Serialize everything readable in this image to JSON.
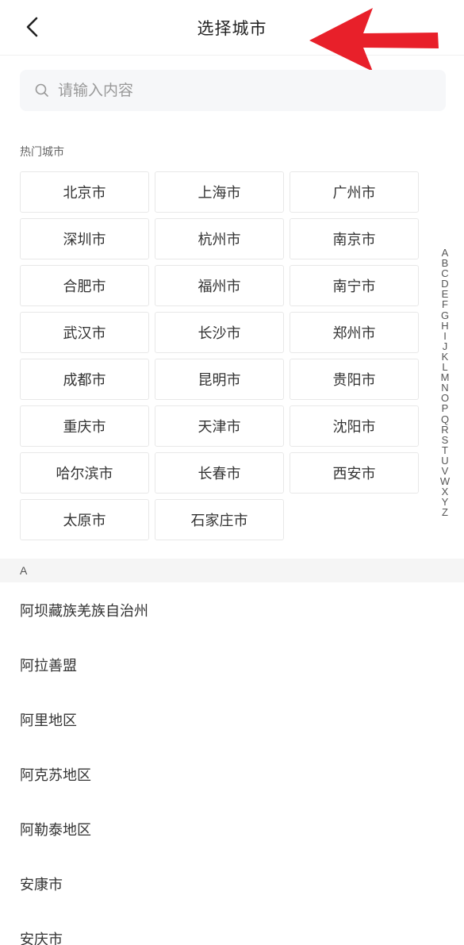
{
  "header": {
    "title": "选择城市",
    "back_icon": "chevron-left-icon",
    "annotation_arrow_color": "#e8202a"
  },
  "search": {
    "placeholder": "请输入内容",
    "icon": "search-icon"
  },
  "hot": {
    "label": "热门城市",
    "cities": [
      "北京市",
      "上海市",
      "广州市",
      "深圳市",
      "杭州市",
      "南京市",
      "合肥市",
      "福州市",
      "南宁市",
      "武汉市",
      "长沙市",
      "郑州市",
      "成都市",
      "昆明市",
      "贵阳市",
      "重庆市",
      "天津市",
      "沈阳市",
      "哈尔滨市",
      "长春市",
      "西安市",
      "太原市",
      "石家庄市"
    ]
  },
  "index_letters": [
    "A",
    "B",
    "C",
    "D",
    "E",
    "F",
    "G",
    "H",
    "I",
    "J",
    "K",
    "L",
    "M",
    "N",
    "O",
    "P",
    "Q",
    "R",
    "S",
    "T",
    "U",
    "V",
    "W",
    "X",
    "Y",
    "Z"
  ],
  "section": {
    "letter": "A",
    "cities": [
      "阿坝藏族羌族自治州",
      "阿拉善盟",
      "阿里地区",
      "阿克苏地区",
      "阿勒泰地区",
      "安康市",
      "安庆市"
    ]
  },
  "colors": {
    "background": "#ffffff",
    "search_bg": "#f6f7f9",
    "section_bg": "#f5f5f5",
    "text": "#333333",
    "arrow": "#e8202a"
  }
}
